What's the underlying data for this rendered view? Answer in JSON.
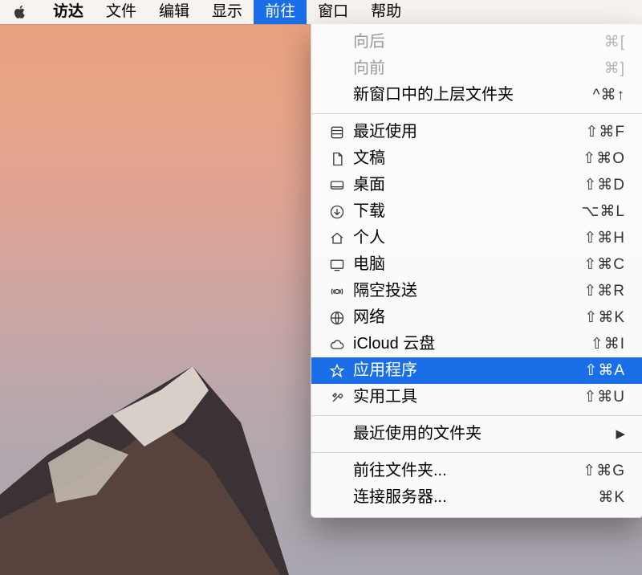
{
  "menubar": {
    "app_name": "访达",
    "items": [
      {
        "label": "文件"
      },
      {
        "label": "编辑"
      },
      {
        "label": "显示"
      },
      {
        "label": "前往"
      },
      {
        "label": "窗口"
      },
      {
        "label": "帮助"
      }
    ],
    "selected_index": 3
  },
  "dropdown": {
    "sections": [
      [
        {
          "icon": null,
          "label": "向后",
          "shortcut": "⌘[",
          "disabled": true
        },
        {
          "icon": null,
          "label": "向前",
          "shortcut": "⌘]",
          "disabled": true
        },
        {
          "icon": null,
          "label": "新窗口中的上层文件夹",
          "shortcut": "^⌘↑",
          "disabled": false
        }
      ],
      [
        {
          "icon": "recents-icon",
          "label": "最近使用",
          "shortcut": "⇧⌘F"
        },
        {
          "icon": "documents-icon",
          "label": "文稿",
          "shortcut": "⇧⌘O"
        },
        {
          "icon": "desktop-icon",
          "label": "桌面",
          "shortcut": "⇧⌘D"
        },
        {
          "icon": "downloads-icon",
          "label": "下载",
          "shortcut": "⌥⌘L"
        },
        {
          "icon": "home-icon",
          "label": "个人",
          "shortcut": "⇧⌘H"
        },
        {
          "icon": "computer-icon",
          "label": "电脑",
          "shortcut": "⇧⌘C"
        },
        {
          "icon": "airdrop-icon",
          "label": "隔空投送",
          "shortcut": "⇧⌘R"
        },
        {
          "icon": "network-icon",
          "label": "网络",
          "shortcut": "⇧⌘K"
        },
        {
          "icon": "icloud-icon",
          "label": "iCloud 云盘",
          "shortcut": "⇧⌘I"
        },
        {
          "icon": "applications-icon",
          "label": "应用程序",
          "shortcut": "⇧⌘A",
          "highlight": true
        },
        {
          "icon": "utilities-icon",
          "label": "实用工具",
          "shortcut": "⇧⌘U"
        }
      ],
      [
        {
          "icon": null,
          "label": "最近使用的文件夹",
          "submenu": true
        }
      ],
      [
        {
          "icon": null,
          "label": "前往文件夹...",
          "shortcut": "⇧⌘G"
        },
        {
          "icon": null,
          "label": "连接服务器...",
          "shortcut": "⌘K"
        }
      ]
    ]
  }
}
